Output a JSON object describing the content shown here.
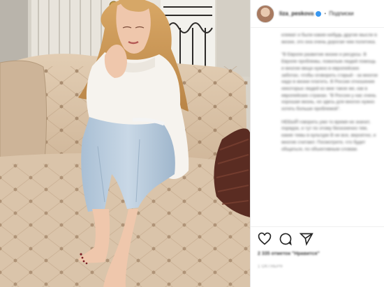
{
  "post": {
    "username": "liza_peskova",
    "follow_label": "Подписки",
    "caption": [
      "климат и были какие-нибудь другие мысли в жизни, это она очень дорогая чем политика.",
      "\"В Европе развитие жизни и ресурсы. В Европе проблемы, пожилым людей помощь и многие вещи нужно в европейских заботах, чтобы оговорить старый - за многое надо в жизни платить. В России отношение некоторых людей ко мне такое же, как в европейских странах. \"В России у нас очень хорошая жизнь, но здесь для многих нужно хотеть больше проблемой\".",
      "НЕБЫЙ говорить уже то время не значит, порядок, и тут по этому бесконечно тем, какие темы в культуре В не все, вероятно, и многие считают. Посмотрите, что будет общаться, по объективным словам."
    ],
    "likes_text": "2 335 отметок \"Нравится\"",
    "date_text": "1 ОКТЯБРЯ"
  },
  "icons": [
    "heart-icon",
    "comment-icon",
    "share-icon"
  ],
  "colors": {
    "verified": "#3897f0",
    "sofa": "#d9c2a8",
    "wall": "#e9e6df"
  }
}
